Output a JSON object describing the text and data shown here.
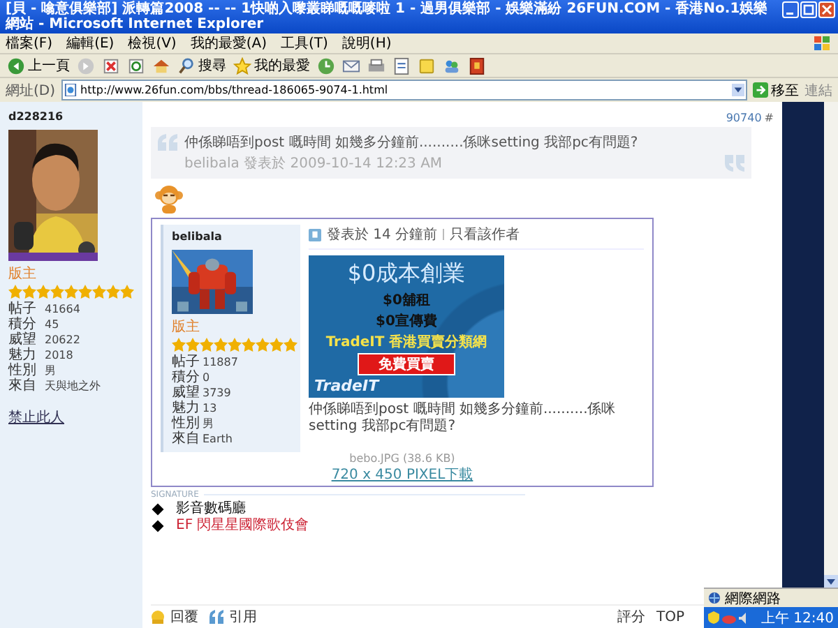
{
  "window": {
    "title": "[貝 - 噏意俱樂部] 派轉篇2008 -- -- 1快啲入嚟叢睇嘅嘅嘜啦 1 - 過男俱樂部 - 娛樂滿紛 26FUN.COM - 香港No.1娛樂網站 - Microsoft Internet Explorer"
  },
  "menu": [
    "檔案(F)",
    "編輯(E)",
    "檢視(V)",
    "我的最愛(A)",
    "工具(T)",
    "說明(H)"
  ],
  "toolbar": [
    {
      "kind": "back",
      "label": "上一頁"
    },
    {
      "kind": "forward"
    },
    {
      "kind": "stop"
    },
    {
      "kind": "refresh"
    },
    {
      "kind": "home"
    },
    {
      "kind": "search",
      "label": "搜尋"
    },
    {
      "kind": "favorites",
      "label": "我的最愛"
    },
    {
      "kind": "history"
    },
    {
      "kind": "mail"
    },
    {
      "kind": "print"
    },
    {
      "kind": "edit"
    },
    {
      "kind": "notes"
    },
    {
      "kind": "messenger"
    },
    {
      "kind": "research"
    }
  ],
  "address": {
    "label": "網址(D)",
    "url": "http://www.26fun.com/bbs/thread-186065-9074-1.html",
    "go": "移至",
    "links": "連結"
  },
  "author": {
    "name": "d228216",
    "rank": "版主",
    "stars": 9,
    "stats": [
      {
        "label": "帖子",
        "value": "41664"
      },
      {
        "label": "積分",
        "value": "45"
      },
      {
        "label": "威望",
        "value": "20622"
      },
      {
        "label": "魅力",
        "value": "2018"
      },
      {
        "label": "性別",
        "value": "男"
      },
      {
        "label": "來自",
        "value": "天與地之外"
      }
    ],
    "ban_link": "禁止此人"
  },
  "post": {
    "number": "90740",
    "number_mark": "#",
    "quote": {
      "text": "仲係睇唔到post 嘅時間 如幾多分鐘前..........係咪setting 我部pc有問題?",
      "byline": "belibala 發表於 2009-10-14 12:23 AM"
    },
    "attachment": {
      "author": {
        "name": "belibala",
        "rank": "版主",
        "stars": 9,
        "stats": [
          {
            "label": "帖子",
            "value": "11887"
          },
          {
            "label": "積分",
            "value": "0"
          },
          {
            "label": "威望",
            "value": "3739"
          },
          {
            "label": "魅力",
            "value": "13"
          },
          {
            "label": "性別",
            "value": "男"
          },
          {
            "label": "來自",
            "value": "Earth"
          }
        ]
      },
      "meta": "發表於 14 分鐘前",
      "meta_link": "只看該作者",
      "ad": {
        "headline": "$0成本創業",
        "lines": [
          "$0舖租",
          "$0宣傳費"
        ],
        "brand_line": "TradeIT 香港買賣分類網",
        "button": "免費買賣",
        "logo": "TradeIT"
      },
      "text": "仲係睇唔到post 嘅時間 如幾多分鐘前..........係咪setting 我部pc有問題?",
      "file": "bebo.JPG (38.6 KB)",
      "download": "720 x 450 PIXEL下載"
    }
  },
  "signature": {
    "label": "SIGNATURE",
    "lines": [
      {
        "text": "影音數碼廳",
        "color": "#111111"
      },
      {
        "text": "EF 閃星星國際歌伎會",
        "color": "#cc2233"
      }
    ]
  },
  "actions": [
    {
      "kind": "reply",
      "label": "回覆"
    },
    {
      "kind": "quote",
      "label": "引用"
    }
  ],
  "tools": [
    "評分",
    "TOP"
  ],
  "tray": {
    "zone": "網際網路",
    "clock": "上午 12:40"
  }
}
